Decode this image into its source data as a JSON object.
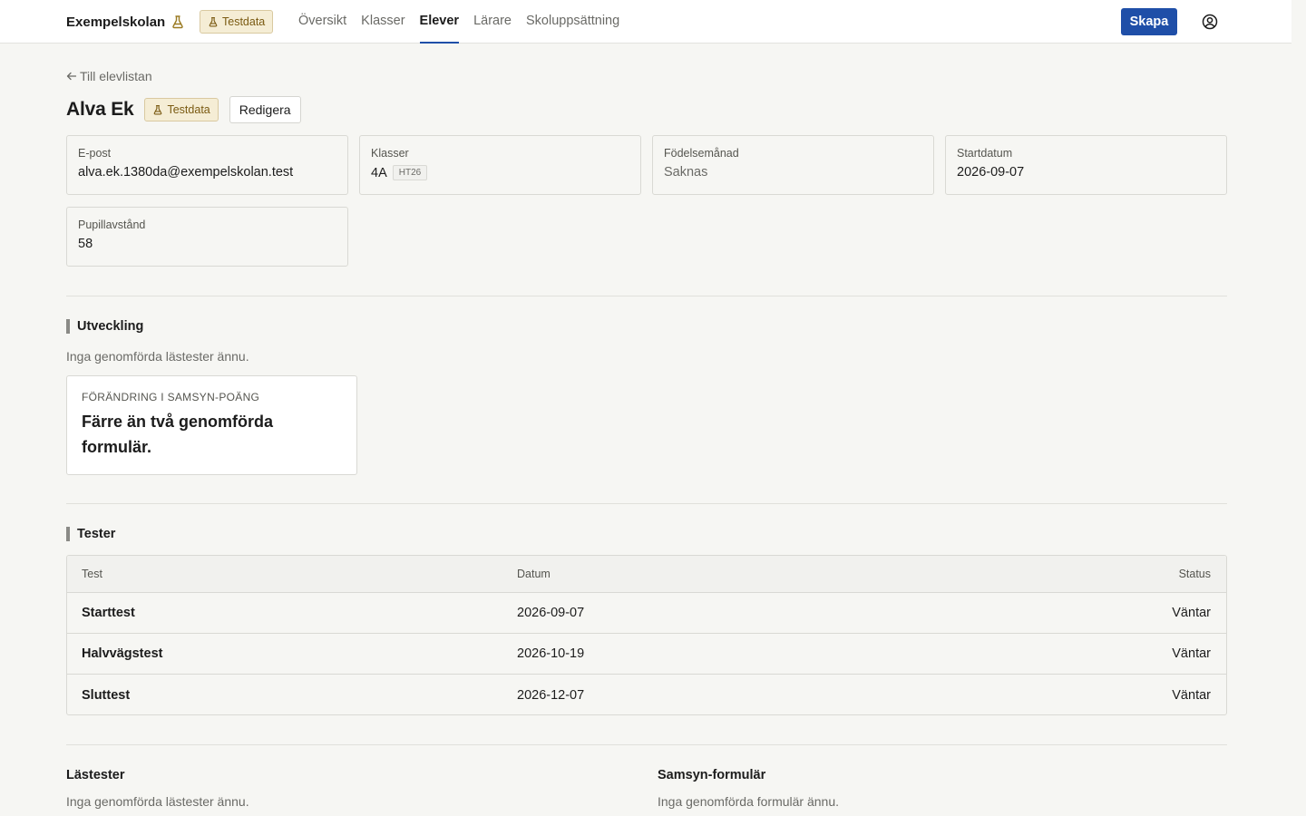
{
  "header": {
    "brand": "Exempelskolan",
    "badge": "Testdata",
    "nav": [
      {
        "label": "Översikt",
        "active": false
      },
      {
        "label": "Klasser",
        "active": false
      },
      {
        "label": "Elever",
        "active": true
      },
      {
        "label": "Lärare",
        "active": false
      },
      {
        "label": "Skoluppsättning",
        "active": false
      }
    ],
    "create_label": "Skapa",
    "accent_color": "#1f4fa8"
  },
  "page": {
    "back_label": "Till elevlistan",
    "title": "Alva Ek",
    "badge": "Testdata",
    "edit_label": "Redigera"
  },
  "info_cards": {
    "email": {
      "label": "E-post",
      "value": "alva.ek.1380da@exempelskolan.test"
    },
    "classes": {
      "label": "Klasser",
      "value": "4A",
      "tag": "HT26"
    },
    "birth_month": {
      "label": "Födelsemånad",
      "value": "Saknas"
    },
    "start_date": {
      "label": "Startdatum",
      "value": "2026-09-07"
    },
    "pupil_distance": {
      "label": "Pupillavstånd",
      "value": "58"
    }
  },
  "development": {
    "heading": "Utveckling",
    "empty_text": "Inga genomförda lästester ännu.",
    "change_card": {
      "label": "Förändring i Samsyn-poäng",
      "value": "Färre än två genomförda formulär."
    }
  },
  "tests": {
    "heading": "Tester",
    "columns": {
      "test": "Test",
      "date": "Datum",
      "status": "Status"
    },
    "rows": [
      {
        "test": "Starttest",
        "date": "2026-09-07",
        "status": "Väntar"
      },
      {
        "test": "Halvvägstest",
        "date": "2026-10-19",
        "status": "Väntar"
      },
      {
        "test": "Sluttest",
        "date": "2026-12-07",
        "status": "Väntar"
      }
    ]
  },
  "reading_tests": {
    "heading": "Lästester",
    "empty_text": "Inga genomförda lästester ännu."
  },
  "samsyn_forms": {
    "heading": "Samsyn-formulär",
    "empty_text": "Inga genomförda formulär ännu."
  }
}
